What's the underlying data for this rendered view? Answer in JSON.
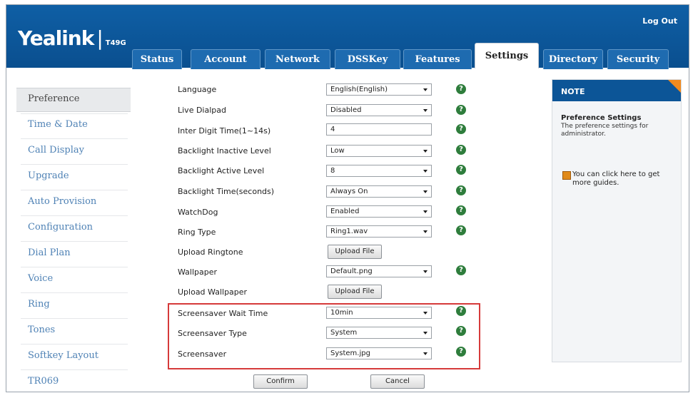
{
  "header": {
    "brand": "Yealink",
    "model": "T49G",
    "logout": "Log Out"
  },
  "tabs": [
    "Status",
    "Account",
    "Network",
    "DSSKey",
    "Features",
    "Settings",
    "Directory",
    "Security"
  ],
  "active_tab": "Settings",
  "sidebar": {
    "items": [
      "Preference",
      "Time & Date",
      "Call Display",
      "Upgrade",
      "Auto Provision",
      "Configuration",
      "Dial Plan",
      "Voice",
      "Ring",
      "Tones",
      "Softkey Layout",
      "TR069"
    ],
    "active": "Preference"
  },
  "form": {
    "rows": [
      {
        "label": "Language",
        "value": "English(English)"
      },
      {
        "label": "Live Dialpad",
        "value": "Disabled"
      },
      {
        "label": "Inter Digit Time(1~14s)",
        "value": "4"
      },
      {
        "label": "Backlight Inactive Level",
        "value": "Low"
      },
      {
        "label": "Backlight Active Level",
        "value": "8"
      },
      {
        "label": "Backlight Time(seconds)",
        "value": "Always On"
      },
      {
        "label": "WatchDog",
        "value": "Enabled"
      },
      {
        "label": "Ring Type",
        "value": "Ring1.wav"
      },
      {
        "label": "Upload Ringtone",
        "button": "Upload File"
      },
      {
        "label": "Wallpaper",
        "value": "Default.png"
      },
      {
        "label": "Upload Wallpaper",
        "button": "Upload File"
      },
      {
        "label": "Screensaver Wait Time",
        "value": "10min"
      },
      {
        "label": "Screensaver Type",
        "value": "System"
      },
      {
        "label": "Screensaver",
        "value": "System.jpg"
      }
    ],
    "confirm": "Confirm",
    "cancel": "Cancel"
  },
  "note": {
    "heading": "NOTE",
    "title": "Preference Settings",
    "text": "The preference settings for administrator.",
    "guide": "You can click here to get more guides."
  },
  "colors": {
    "header_blue": "#0f5fa5",
    "highlight_red": "#d63a3a",
    "help_green": "#2e7d3c",
    "note_corner": "#f08a1e"
  }
}
